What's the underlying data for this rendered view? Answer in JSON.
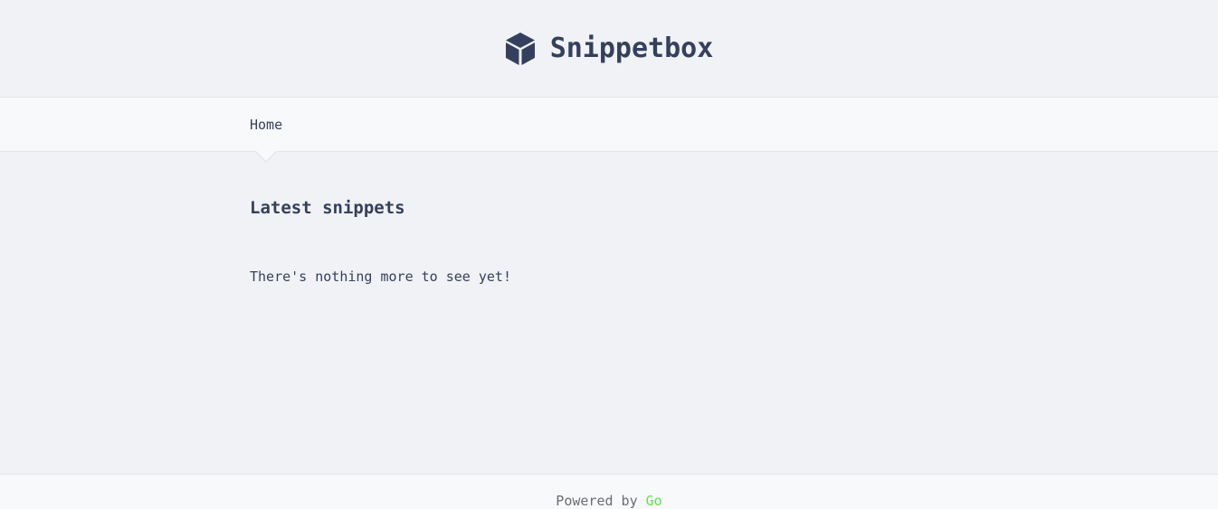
{
  "header": {
    "title": "Snippetbox",
    "logo_icon": "cube-icon"
  },
  "nav": {
    "items": [
      {
        "label": "Home"
      }
    ]
  },
  "main": {
    "heading": "Latest snippets",
    "empty_message": "There's nothing more to see yet!"
  },
  "footer": {
    "powered_by_text": "Powered by",
    "go_link_label": "Go"
  },
  "colors": {
    "background": "#f1f2f5",
    "bar_background": "#f8f9fb",
    "text": "#34405e",
    "go_green": "#62e04b"
  }
}
